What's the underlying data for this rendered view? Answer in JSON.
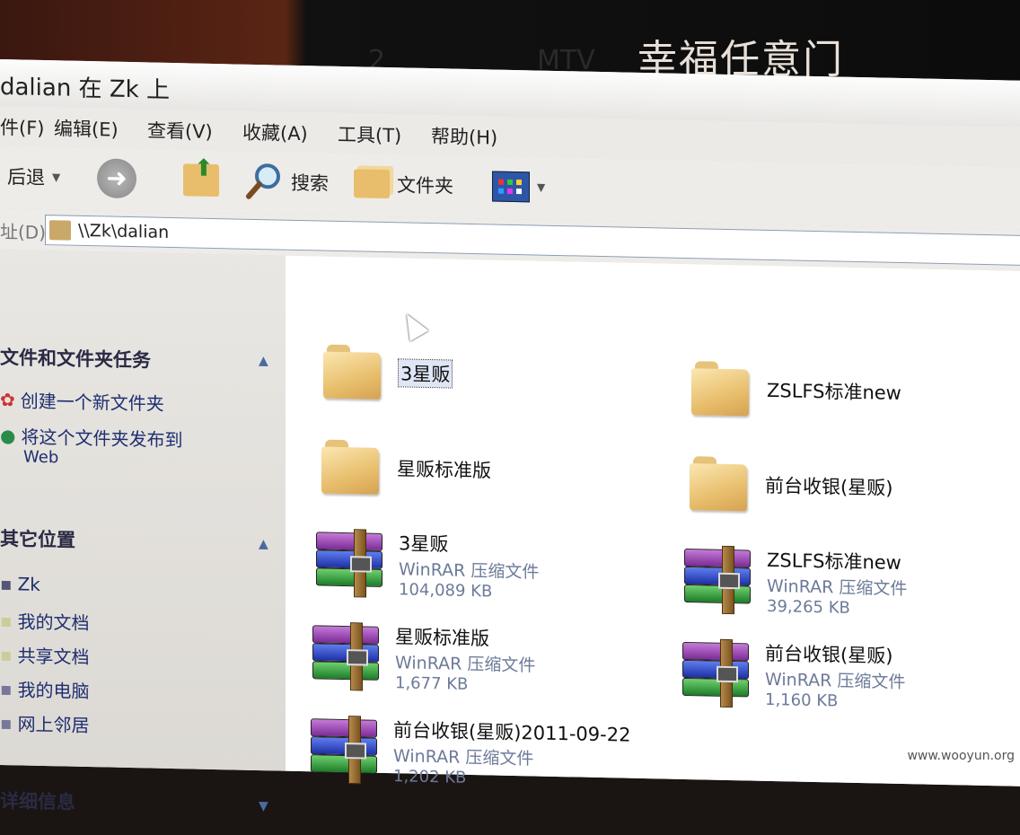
{
  "overlay": {
    "title": "幸福任意门",
    "ghost_a": "2",
    "ghost_b": "MTV"
  },
  "window": {
    "title": "dalian 在 Zk 上"
  },
  "menu": [
    "件(F)",
    "编辑(E)",
    "查看(V)",
    "收藏(A)",
    "工具(T)",
    "帮助(H)"
  ],
  "toolbar": {
    "back_label": "后退",
    "search_label": "搜索",
    "folders_label": "文件夹",
    "icons": [
      "back-arrow-icon",
      "forward-arrow-icon",
      "up-folder-icon",
      "search-magnifier-icon",
      "folders-icon",
      "views-icon"
    ]
  },
  "address": {
    "label": "址(D)",
    "path": "\\\\Zk\\dalian"
  },
  "sidebar": {
    "tasks_title": "文件和文件夹任务",
    "task_new_folder": "创建一个新文件夹",
    "task_publish": "将这个文件夹发布到",
    "task_publish_sub": "Web",
    "places_title": "其它位置",
    "places": [
      "Zk",
      "我的文档",
      "共享文档",
      "我的电脑",
      "网上邻居"
    ],
    "details_title": "详细信息"
  },
  "files": [
    {
      "name": "3星贩",
      "kind": "folder"
    },
    {
      "name": "ZSLFS标准new",
      "kind": "folder"
    },
    {
      "name": "星贩标准版",
      "kind": "folder"
    },
    {
      "name": "前台收银(星贩)",
      "kind": "folder"
    },
    {
      "name": "3星贩",
      "type": "WinRAR 压缩文件",
      "size": "104,089 KB",
      "kind": "rar"
    },
    {
      "name": "ZSLFS标准new",
      "type": "WinRAR 压缩文件",
      "size": "39,265 KB",
      "kind": "rar"
    },
    {
      "name": "星贩标准版",
      "type": "WinRAR 压缩文件",
      "size": "1,677 KB",
      "kind": "rar"
    },
    {
      "name": "前台收银(星贩)",
      "type": "WinRAR 压缩文件",
      "size": "1,160 KB",
      "kind": "rar"
    },
    {
      "name": "前台收银(星贩)2011-09-22",
      "type": "WinRAR 压缩文件",
      "size": "1,202 KB",
      "kind": "rar"
    }
  ],
  "watermark": "www.wooyun.org",
  "colors": {
    "link": "#1e2e70",
    "folder": "#e8be6c",
    "type_text": "#6c7a99"
  }
}
